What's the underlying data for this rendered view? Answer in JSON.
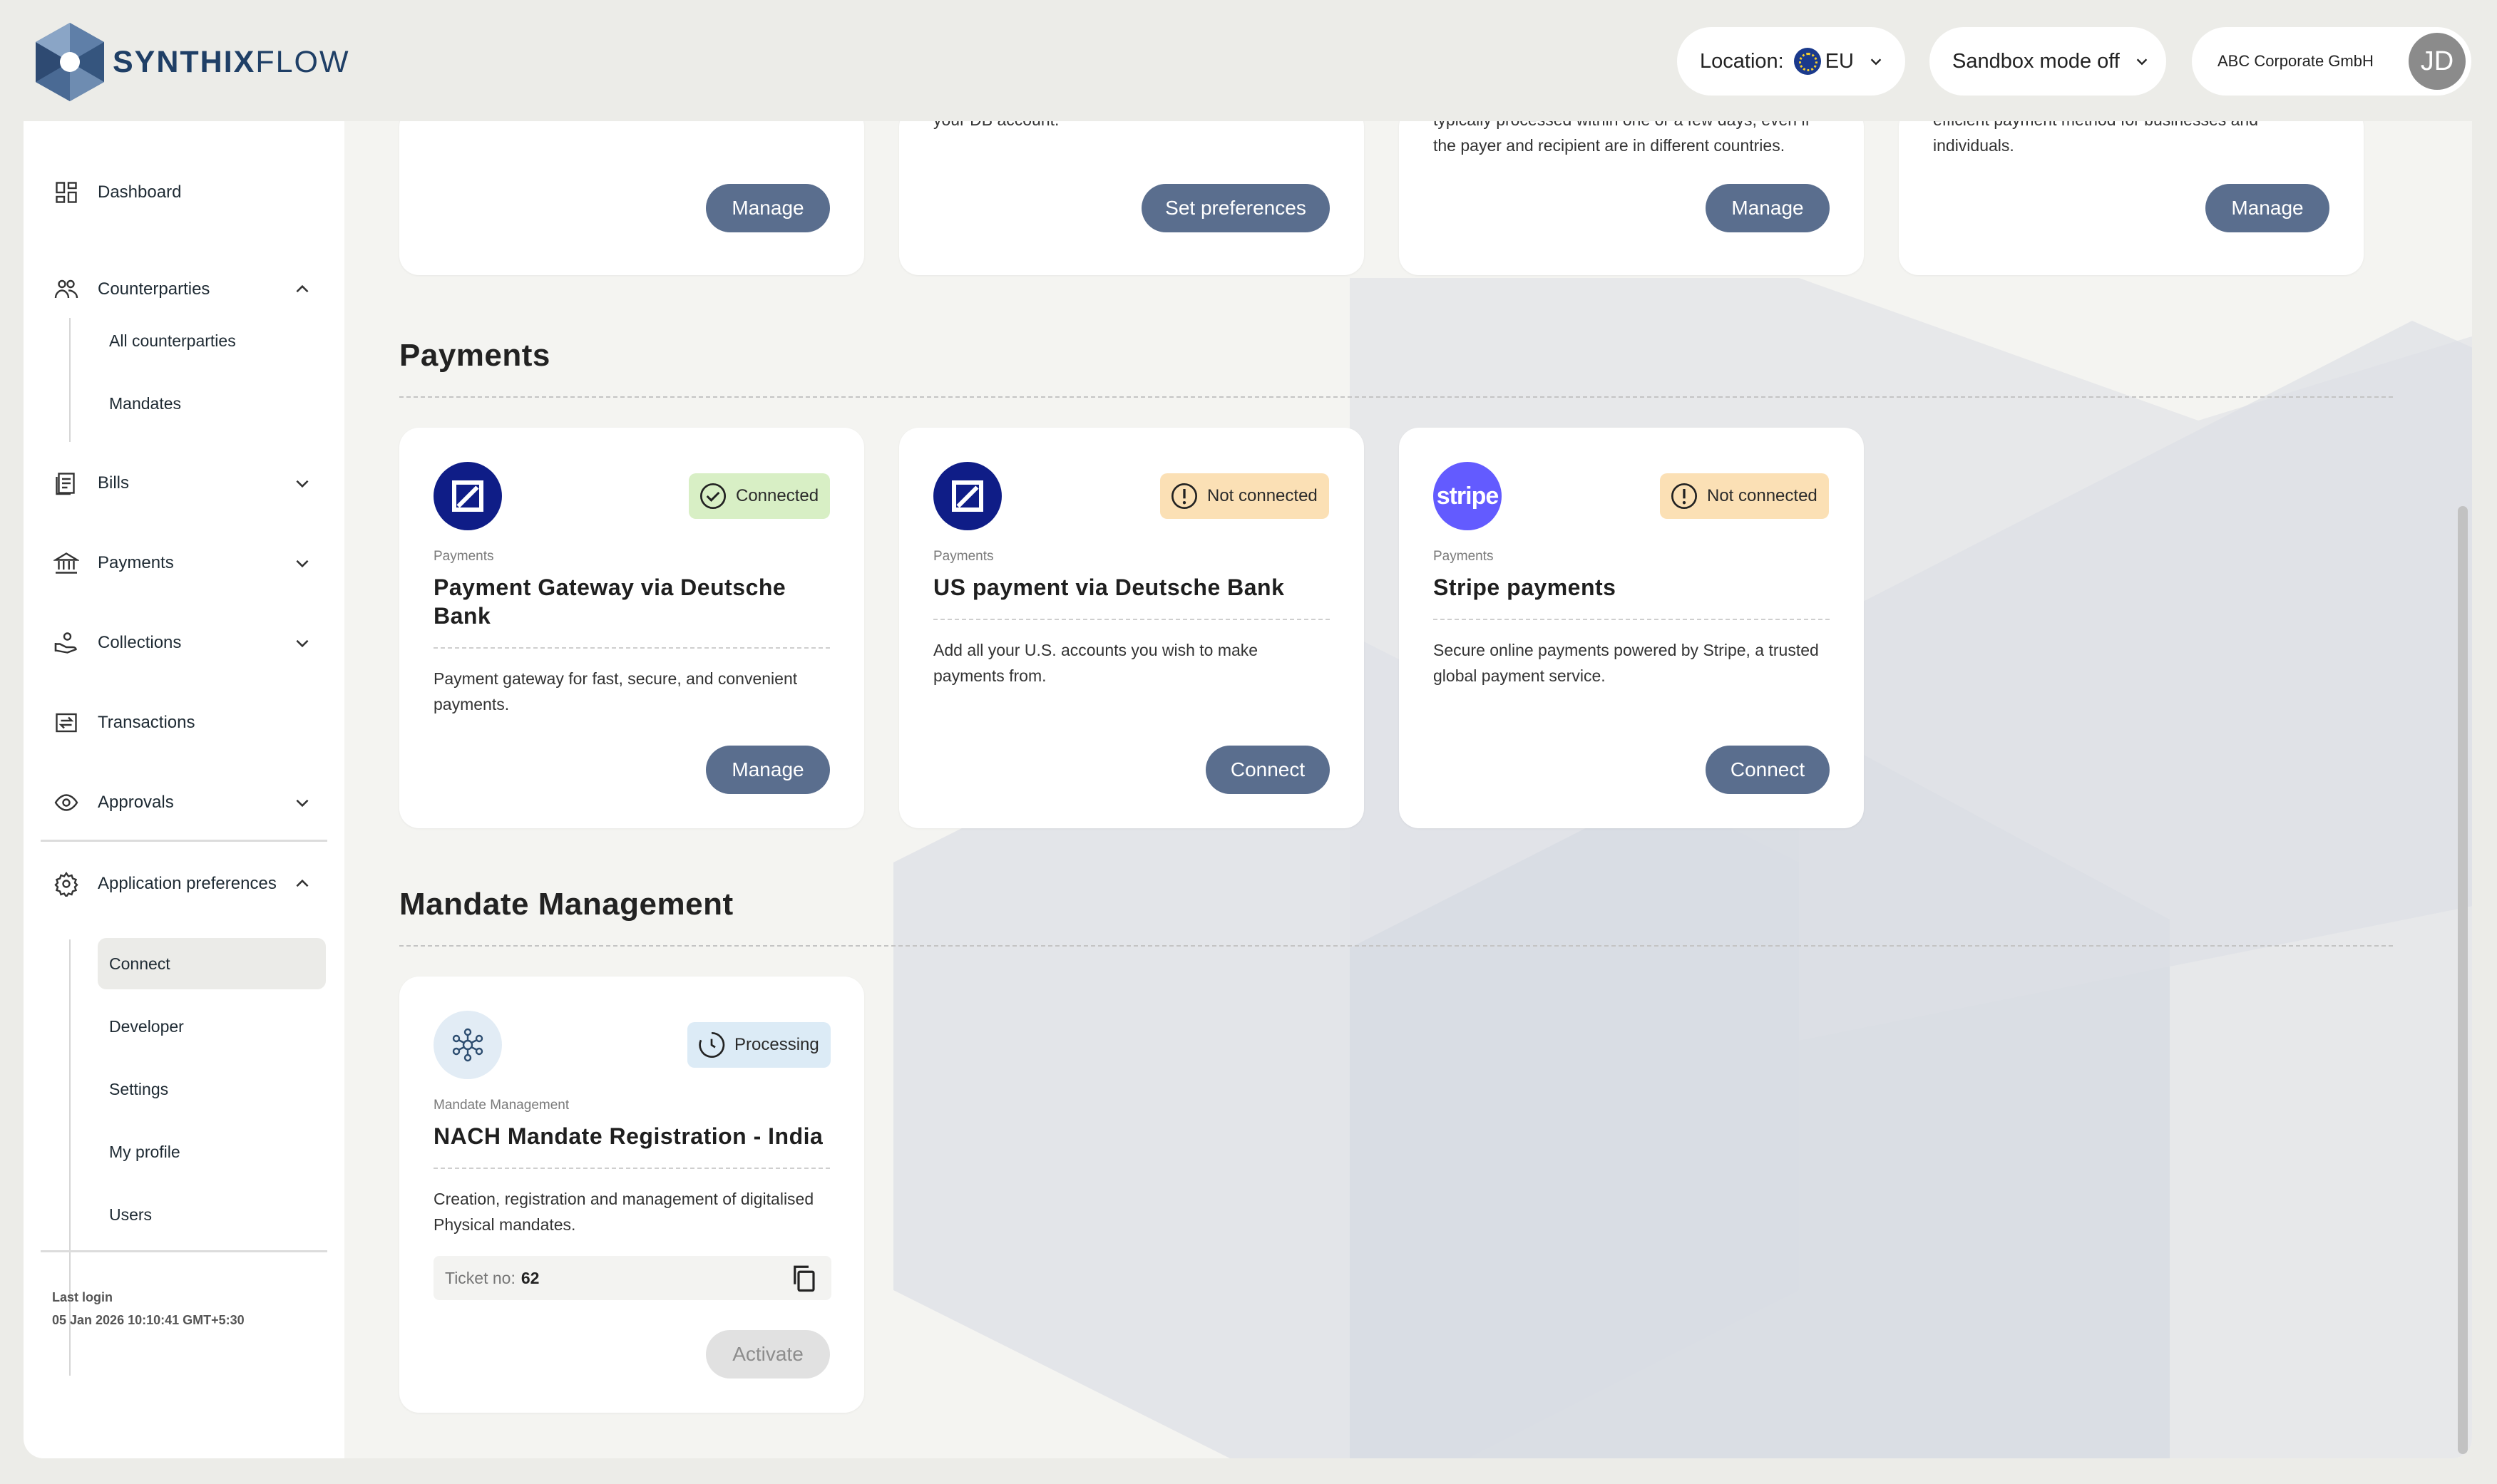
{
  "brand": {
    "name_bold": "SYNTHIX",
    "name_light": "FLOW"
  },
  "header": {
    "location_label": "Location:",
    "location_value": "EU",
    "sandbox_label": "Sandbox mode off",
    "account_name": "ABC Corporate GmbH",
    "avatar_initials": "JD"
  },
  "sidebar": {
    "items": [
      {
        "label": "Dashboard",
        "icon": "dashboard-icon"
      },
      {
        "label": "Counterparties",
        "icon": "people-icon",
        "expanded": true,
        "children": [
          "All counterparties",
          "Mandates"
        ]
      },
      {
        "label": "Bills",
        "icon": "bills-icon",
        "expanded": false
      },
      {
        "label": "Payments",
        "icon": "bank-icon",
        "expanded": false
      },
      {
        "label": "Collections",
        "icon": "collections-icon",
        "expanded": false
      },
      {
        "label": "Transactions",
        "icon": "transactions-icon"
      },
      {
        "label": "Approvals",
        "icon": "eye-icon",
        "expanded": false
      },
      {
        "label": "Application preferences",
        "icon": "gear-icon",
        "expanded": true,
        "children": [
          "Connect",
          "Developer",
          "Settings",
          "My profile",
          "Users"
        ]
      }
    ],
    "active_child": "Connect",
    "last_login_label": "Last login",
    "last_login_value": "05 Jan 2026 10:10:41 GMT+5:30"
  },
  "top_cards": [
    {
      "desc": "",
      "button": "Manage"
    },
    {
      "desc": "your DB account.",
      "button": "Set preferences"
    },
    {
      "desc": "typically processed within one or a few days, even if the payer and recipient are in different countries.",
      "button": "Manage"
    },
    {
      "desc": "efficient payment method for businesses and individuals.",
      "button": "Manage"
    }
  ],
  "payments_section": {
    "title": "Payments",
    "cards": [
      {
        "category": "Payments",
        "title": "Payment Gateway via Deutsche Bank",
        "status": "Connected",
        "desc": "Payment gateway for fast, secure, and convenient payments.",
        "button": "Manage",
        "logo": "deutsche-bank-icon"
      },
      {
        "category": "Payments",
        "title": "US payment via Deutsche Bank",
        "status": "Not connected",
        "desc": "Add all your U.S. accounts you wish to make payments from.",
        "button": "Connect",
        "logo": "deutsche-bank-icon"
      },
      {
        "category": "Payments",
        "title": "Stripe payments",
        "status": "Not connected",
        "desc": "Secure online payments powered by Stripe, a trusted global payment service.",
        "button": "Connect",
        "logo": "stripe-icon",
        "logo_text": "stripe"
      }
    ]
  },
  "mandate_section": {
    "title": "Mandate Management",
    "card": {
      "category": "Mandate Management",
      "title": "NACH Mandate Registration - India",
      "status": "Processing",
      "desc": "Creation, registration and management of digitalised Physical mandates.",
      "ticket_label": "Ticket no:",
      "ticket_value": "62",
      "button": "Activate"
    }
  },
  "colors": {
    "button": "#5a6e8e",
    "connected": "#d8efc5",
    "not_connected": "#fbe0b5",
    "processing": "#dcebf6",
    "stripe": "#635bff",
    "deutsche_bank": "#0f1d87"
  }
}
